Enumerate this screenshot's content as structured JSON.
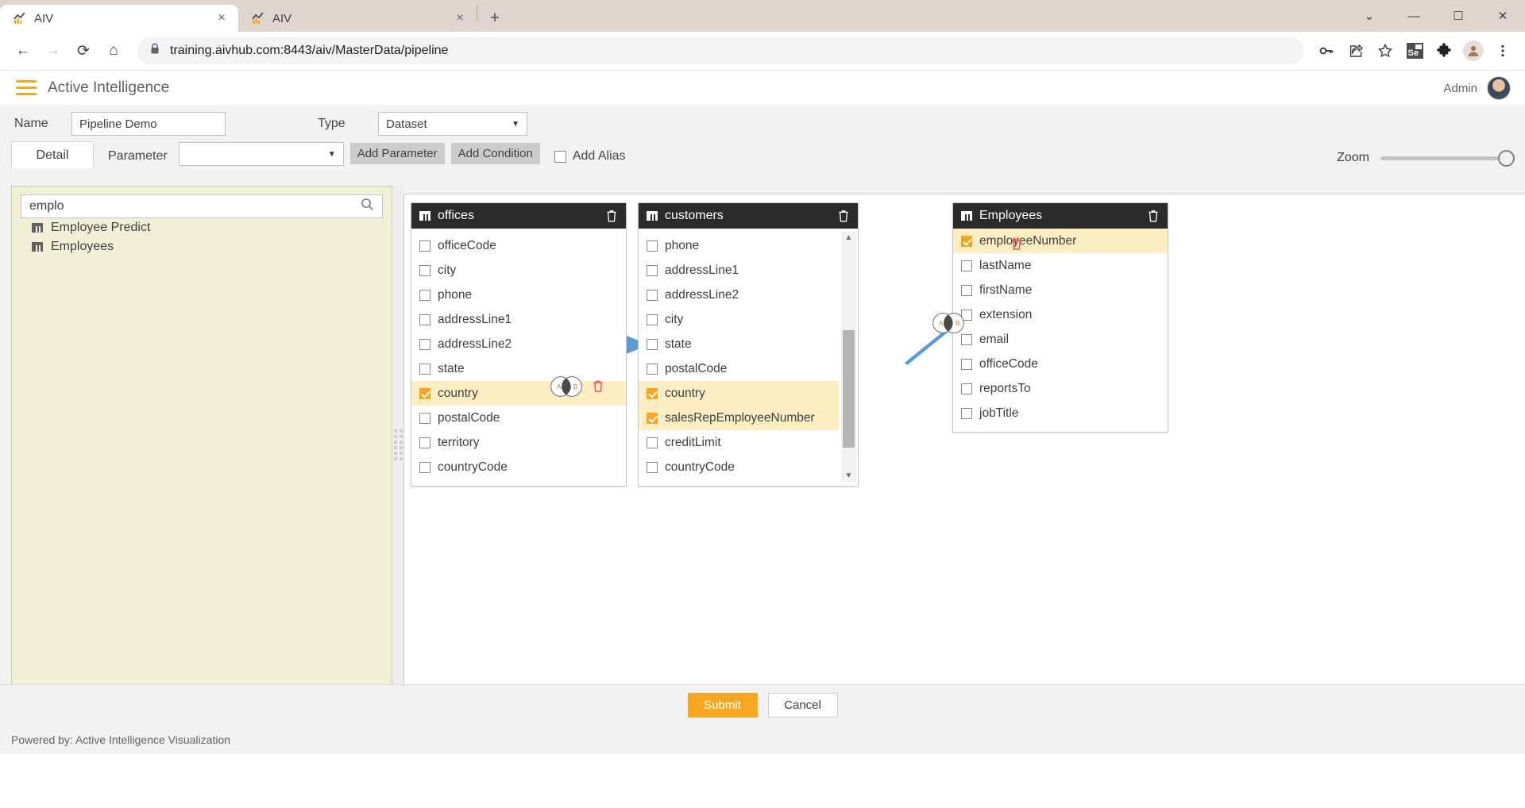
{
  "browser": {
    "tabs": [
      {
        "title": "AIV",
        "favicon": "aiv-chart-icon",
        "active": true
      },
      {
        "title": "AIV",
        "favicon": "aiv-chart-icon",
        "active": false
      }
    ],
    "new_tab_label": "+",
    "close_label": "×",
    "window_controls": {
      "restore_down": "⌄",
      "minimize": "—",
      "maximize": "☐",
      "close": "✕"
    },
    "nav": {
      "back": "←",
      "forward": "→",
      "reload": "⟳",
      "home": "⌂"
    },
    "url": "training.aivhub.com:8443/aiv/MasterData/pipeline",
    "lock_icon": "🔒",
    "toolbar_icons": [
      "key-icon",
      "share-icon",
      "bookmark-star-icon",
      "selenium-extension-icon",
      "extensions-puzzle-icon",
      "browser-profile-icon",
      "chrome-menu-icon"
    ],
    "selenium_badge": "Se"
  },
  "app": {
    "title": "Active Intelligence",
    "user": "Admin"
  },
  "form": {
    "name_label": "Name",
    "name_value": "Pipeline Demo",
    "type_label": "Type",
    "type_value": "Dataset"
  },
  "toolbar": {
    "detail_tab": "Detail",
    "parameter_label": "Parameter",
    "parameter_value": "",
    "add_parameter": "Add Parameter",
    "add_condition": "Add Condition",
    "add_alias": "Add Alias",
    "add_alias_checked": false,
    "zoom_label": "Zoom",
    "zoom_value": 100
  },
  "sidebar": {
    "search_value": "emplo",
    "search_placeholder": "",
    "search_icon": "search-icon",
    "items": [
      {
        "label": "Employee Predict",
        "icon": "table-icon"
      },
      {
        "label": "Employees",
        "icon": "table-icon"
      }
    ]
  },
  "canvas": {
    "panels": [
      {
        "name": "offices",
        "icon": "table-icon",
        "delete_icon": "trash-icon",
        "has_scrollbar": false,
        "fields": [
          {
            "label": "officeCode",
            "checked": false
          },
          {
            "label": "city",
            "checked": false
          },
          {
            "label": "phone",
            "checked": false
          },
          {
            "label": "addressLine1",
            "checked": false
          },
          {
            "label": "addressLine2",
            "checked": false
          },
          {
            "label": "state",
            "checked": false
          },
          {
            "label": "country",
            "checked": true
          },
          {
            "label": "postalCode",
            "checked": false
          },
          {
            "label": "territory",
            "checked": false
          },
          {
            "label": "countryCode",
            "checked": false
          }
        ]
      },
      {
        "name": "customers",
        "icon": "table-icon",
        "delete_icon": "trash-icon",
        "has_scrollbar": true,
        "fields": [
          {
            "label": "phone",
            "checked": false
          },
          {
            "label": "addressLine1",
            "checked": false
          },
          {
            "label": "addressLine2",
            "checked": false
          },
          {
            "label": "city",
            "checked": false
          },
          {
            "label": "state",
            "checked": false
          },
          {
            "label": "postalCode",
            "checked": false
          },
          {
            "label": "country",
            "checked": true
          },
          {
            "label": "salesRepEmployeeNumber",
            "checked": true
          },
          {
            "label": "creditLimit",
            "checked": false
          },
          {
            "label": "countryCode",
            "checked": false
          }
        ]
      },
      {
        "name": "Employees",
        "icon": "table-icon",
        "delete_icon": "trash-icon",
        "has_scrollbar": false,
        "fields": [
          {
            "label": "employeeNumber",
            "checked": true
          },
          {
            "label": "lastName",
            "checked": false
          },
          {
            "label": "firstName",
            "checked": false
          },
          {
            "label": "extension",
            "checked": false
          },
          {
            "label": "email",
            "checked": false
          },
          {
            "label": "officeCode",
            "checked": false
          },
          {
            "label": "reportsTo",
            "checked": false
          },
          {
            "label": "jobTitle",
            "checked": false
          }
        ]
      }
    ],
    "joins": [
      {
        "from": "offices.country",
        "to": "customers.country",
        "type": "inner",
        "left_label": "A",
        "right_label": "B",
        "delete_icon": "trash-icon"
      },
      {
        "from": "customers.salesRepEmployeeNumber",
        "to": "Employees.employeeNumber",
        "type": "inner",
        "left_label": "A",
        "right_label": "B",
        "delete_icon": "trash-icon"
      }
    ]
  },
  "actions": {
    "submit": "Submit",
    "cancel": "Cancel"
  },
  "footer": {
    "text": "Powered by: Active Intelligence Visualization"
  },
  "colors": {
    "accent": "#f5a623",
    "panel_header": "#2b2b2b",
    "selected_row": "#fdeec4",
    "sidebar_bg": "#f2f1d7",
    "connector": "#5b9bd5",
    "delete": "#ff4d4d"
  }
}
